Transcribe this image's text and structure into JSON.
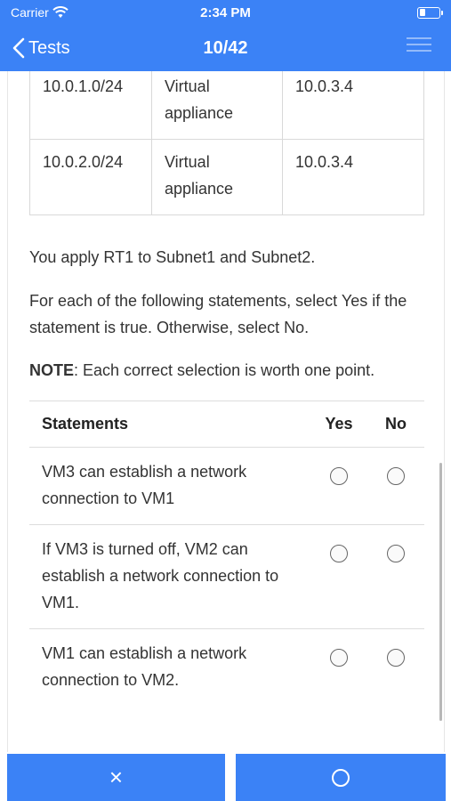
{
  "status": {
    "carrier": "Carrier",
    "time": "2:34 PM"
  },
  "nav": {
    "back_label": "Tests",
    "progress": "10/42"
  },
  "route_table": {
    "rows": [
      [
        "10.0.1.0/24",
        "Virtual appliance",
        "10.0.3.4"
      ],
      [
        "10.0.2.0/24",
        "Virtual appliance",
        "10.0.3.4"
      ]
    ]
  },
  "question": {
    "apply_text": "You apply RT1 to Subnet1 and Subnet2.",
    "instruction": "For each of the following statements, select Yes if the statement is true. Otherwise, select No.",
    "note_label": "NOTE",
    "note_text": ": Each correct selection is worth one point."
  },
  "statements": {
    "headers": {
      "statement": "Statements",
      "yes": "Yes",
      "no": "No"
    },
    "rows": [
      "VM3 can establish a network connection to VM1",
      "If VM3 is turned off, VM2 can establish a network connection to VM1.",
      "VM1 can establish a network connection to VM2."
    ]
  },
  "actions": {
    "wrong_symbol": "×"
  },
  "colors": {
    "accent": "#3b82f6"
  }
}
